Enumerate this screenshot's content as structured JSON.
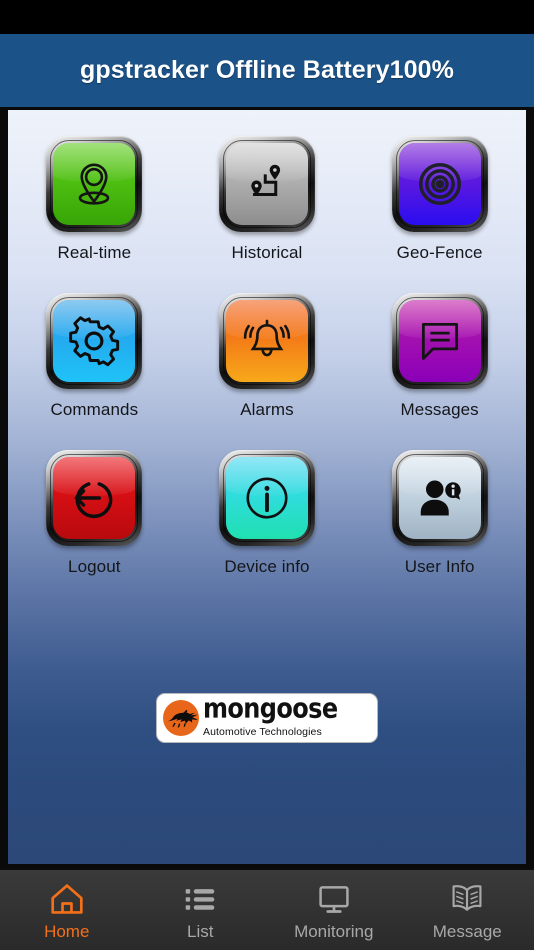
{
  "app": {
    "header_title": "gpstracker Offline Battery100%",
    "header_bg": "#1b5288",
    "accent": "#f2701a"
  },
  "grid": {
    "items": [
      {
        "label": "Real-time",
        "icon": "map-pin-icon",
        "face": "face-green",
        "color": "#4fbf12"
      },
      {
        "label": "Historical",
        "icon": "route-history-icon",
        "face": "face-silver",
        "color": "#b0b0b0"
      },
      {
        "label": "Geo-Fence",
        "icon": "target-rings-icon",
        "face": "face-violet",
        "color": "#5a18e0"
      },
      {
        "label": "Commands",
        "icon": "gear-icon",
        "face": "face-blue",
        "color": "#24a9ef"
      },
      {
        "label": "Alarms",
        "icon": "bell-icon",
        "face": "face-orange",
        "color": "#f47c18"
      },
      {
        "label": "Messages",
        "icon": "speech-bubble-icon",
        "face": "face-magenta",
        "color": "#a511b0"
      },
      {
        "label": "Logout",
        "icon": "power-exit-icon",
        "face": "face-red",
        "color": "#d60f14"
      },
      {
        "label": "Device info",
        "icon": "info-circle-icon",
        "face": "face-cyan",
        "color": "#2fdcdc"
      },
      {
        "label": "User Info",
        "icon": "user-info-icon",
        "face": "face-steel",
        "color": "#c3d3e0"
      }
    ]
  },
  "logo": {
    "word": "mongoose",
    "tagline": "Automotive Technologies",
    "mark_color": "#e8661a"
  },
  "tabbar": {
    "tabs": [
      {
        "label": "Home",
        "icon": "home-icon",
        "active": true
      },
      {
        "label": "List",
        "icon": "list-icon",
        "active": false
      },
      {
        "label": "Monitoring",
        "icon": "monitor-icon",
        "active": false
      },
      {
        "label": "Message",
        "icon": "book-icon",
        "active": false
      }
    ]
  }
}
